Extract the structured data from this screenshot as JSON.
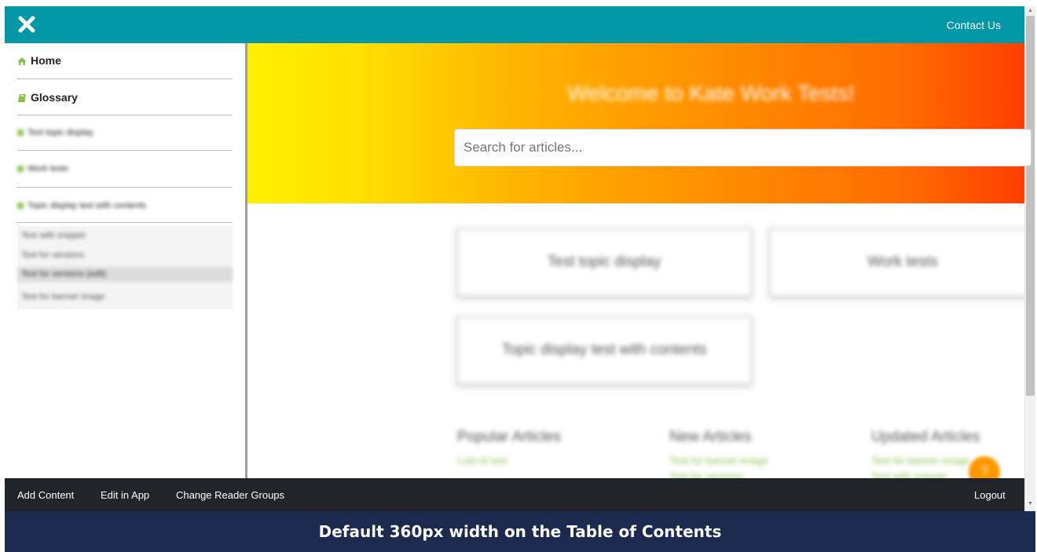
{
  "topbar": {
    "contact_label": "Contact Us",
    "color": "#0097a7"
  },
  "sidebar": {
    "items": [
      {
        "label": "Home",
        "icon": "home-icon",
        "icon_color": "#8bc34a"
      },
      {
        "label": "Glossary",
        "icon": "book-icon",
        "icon_color": "#8bc34a"
      }
    ],
    "topics": [
      {
        "label": "Test topic display"
      },
      {
        "label": "Work tests"
      },
      {
        "label": "Topic display test with contents"
      }
    ],
    "sub_items": [
      {
        "label": "Test with snippet"
      },
      {
        "label": "Test for versions"
      },
      {
        "label": "Test for versions (edit)"
      },
      {
        "label": "Test for banner image"
      }
    ]
  },
  "hero": {
    "title": "Welcome to Kate Work Tests!",
    "search_placeholder": "Search for articles..."
  },
  "cards": [
    {
      "label": "Test topic display"
    },
    {
      "label": "Work tests"
    },
    {
      "label": "Topic display test with contents"
    }
  ],
  "columns": [
    {
      "title": "Popular Articles",
      "links": [
        "Lots of text"
      ]
    },
    {
      "title": "New Articles",
      "links": [
        "Test for banner image",
        "Test for versions"
      ]
    },
    {
      "title": "Updated Articles",
      "links": [
        "Test for banner image",
        "Test with snippet"
      ]
    }
  ],
  "help_fab": {
    "label": "?",
    "color": "#ff9800"
  },
  "bottombar": {
    "add_content": "Add Content",
    "edit_in_app": "Edit in App",
    "change_reader_groups": "Change Reader Groups",
    "logout": "Logout"
  },
  "caption": "Default 360px width on the Table of Contents"
}
